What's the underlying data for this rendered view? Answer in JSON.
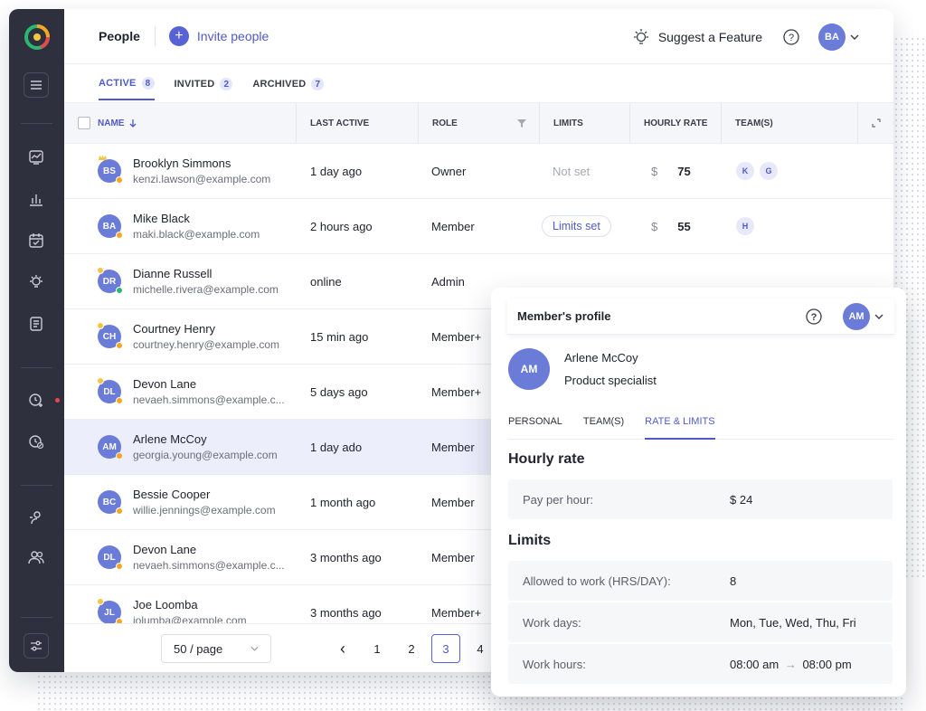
{
  "header": {
    "title": "People",
    "invite_label": "Invite people",
    "suggest_label": "Suggest a Feature",
    "user_initials": "BA"
  },
  "tabs": [
    {
      "label": "ACTIVE",
      "count": "8"
    },
    {
      "label": "INVITED",
      "count": "2"
    },
    {
      "label": "ARCHIVED",
      "count": "7"
    }
  ],
  "table": {
    "columns": [
      "NAME",
      "LAST ACTIVE",
      "ROLE",
      "LIMITS",
      "HOURLY RATE",
      "TEAM(S)"
    ],
    "rows": [
      {
        "initials": "BS",
        "name": "Brooklyn Simmons",
        "email": "kenzi.lawson@example.com",
        "last_active": "1 day ago",
        "role": "Owner",
        "limits": "Not set",
        "currency": "$",
        "rate": "75",
        "teams": [
          "K",
          "G"
        ]
      },
      {
        "initials": "BA",
        "name": "Mike Black",
        "email": "maki.black@example.com",
        "last_active": "2 hours ago",
        "role": "Member",
        "limits": "Limits set",
        "currency": "$",
        "rate": "55",
        "teams": [
          "H"
        ]
      },
      {
        "initials": "DR",
        "name": "Dianne Russell",
        "email": "michelle.rivera@example.com",
        "last_active": "online",
        "role": "Admin",
        "limits": "",
        "currency": "",
        "rate": "",
        "teams": []
      },
      {
        "initials": "CH",
        "name": "Courtney Henry",
        "email": "courtney.henry@example.com",
        "last_active": "15 min ago",
        "role": "Member+"
      },
      {
        "initials": "DL",
        "name": "Devon Lane",
        "email": "nevaeh.simmons@example.c...",
        "last_active": "5 days ago",
        "role": "Member+"
      },
      {
        "initials": "AM",
        "name": "Arlene McCoy",
        "email": "georgia.young@example.com",
        "last_active": "1 day ado",
        "role": "Member"
      },
      {
        "initials": "BC",
        "name": "Bessie Cooper",
        "email": "willie.jennings@example.com",
        "last_active": "1 month ago",
        "role": "Member"
      },
      {
        "initials": "DL",
        "name": "Devon Lane",
        "email": "nevaeh.simmons@example.c...",
        "last_active": "3 months ago",
        "role": "Member"
      },
      {
        "initials": "JL",
        "name": "Joe Loomba",
        "email": "jolumba@example.com",
        "last_active": "3 months ago",
        "role": "Member+"
      }
    ]
  },
  "pagination": {
    "per_page": "50 / page",
    "prev": "‹",
    "pages": [
      "1",
      "2",
      "3",
      "4"
    ],
    "current": "3"
  },
  "profile_panel": {
    "title": "Member's profile",
    "user_initials": "AM",
    "member_initials": "AM",
    "member_name": "Arlene McCoy",
    "member_title": "Product specialist",
    "tabs": [
      "PERSONAL",
      "TEAM(S)",
      "RATE & LIMITS"
    ],
    "active_tab": "RATE & LIMITS",
    "hourly_rate_heading": "Hourly rate",
    "pay_label": "Pay per hour:",
    "pay_value": "$ 24",
    "limits_heading": "Limits",
    "allowed_label": "Allowed to work (HRS/DAY):",
    "allowed_value": "8",
    "days_label": "Work days:",
    "days_value": "Mon, Tue, Wed, Thu, Fri",
    "hours_label": "Work hours:",
    "hours_start": "08:00 am",
    "hours_arrow": "→",
    "hours_end": "08:00 pm"
  },
  "colors": {
    "accent": "#5762d5",
    "sidebar": "#2f303d",
    "avatar": "#6a7bd8",
    "status_online": "#2bb673",
    "status_away": "#f5a623",
    "notification": "#e5484d"
  },
  "icons": [
    "logo-icon",
    "menu-icon",
    "dashboard-icon",
    "chart-icon",
    "calendar-icon",
    "bulb-icon",
    "document-icon",
    "clock-add-icon",
    "clock-off-icon",
    "user-icon",
    "users-icon",
    "settings-sliders-icon",
    "help-icon",
    "chevron-down-icon",
    "sort-arrow-icon",
    "filter-icon",
    "expand-icon",
    "crown-icon"
  ]
}
